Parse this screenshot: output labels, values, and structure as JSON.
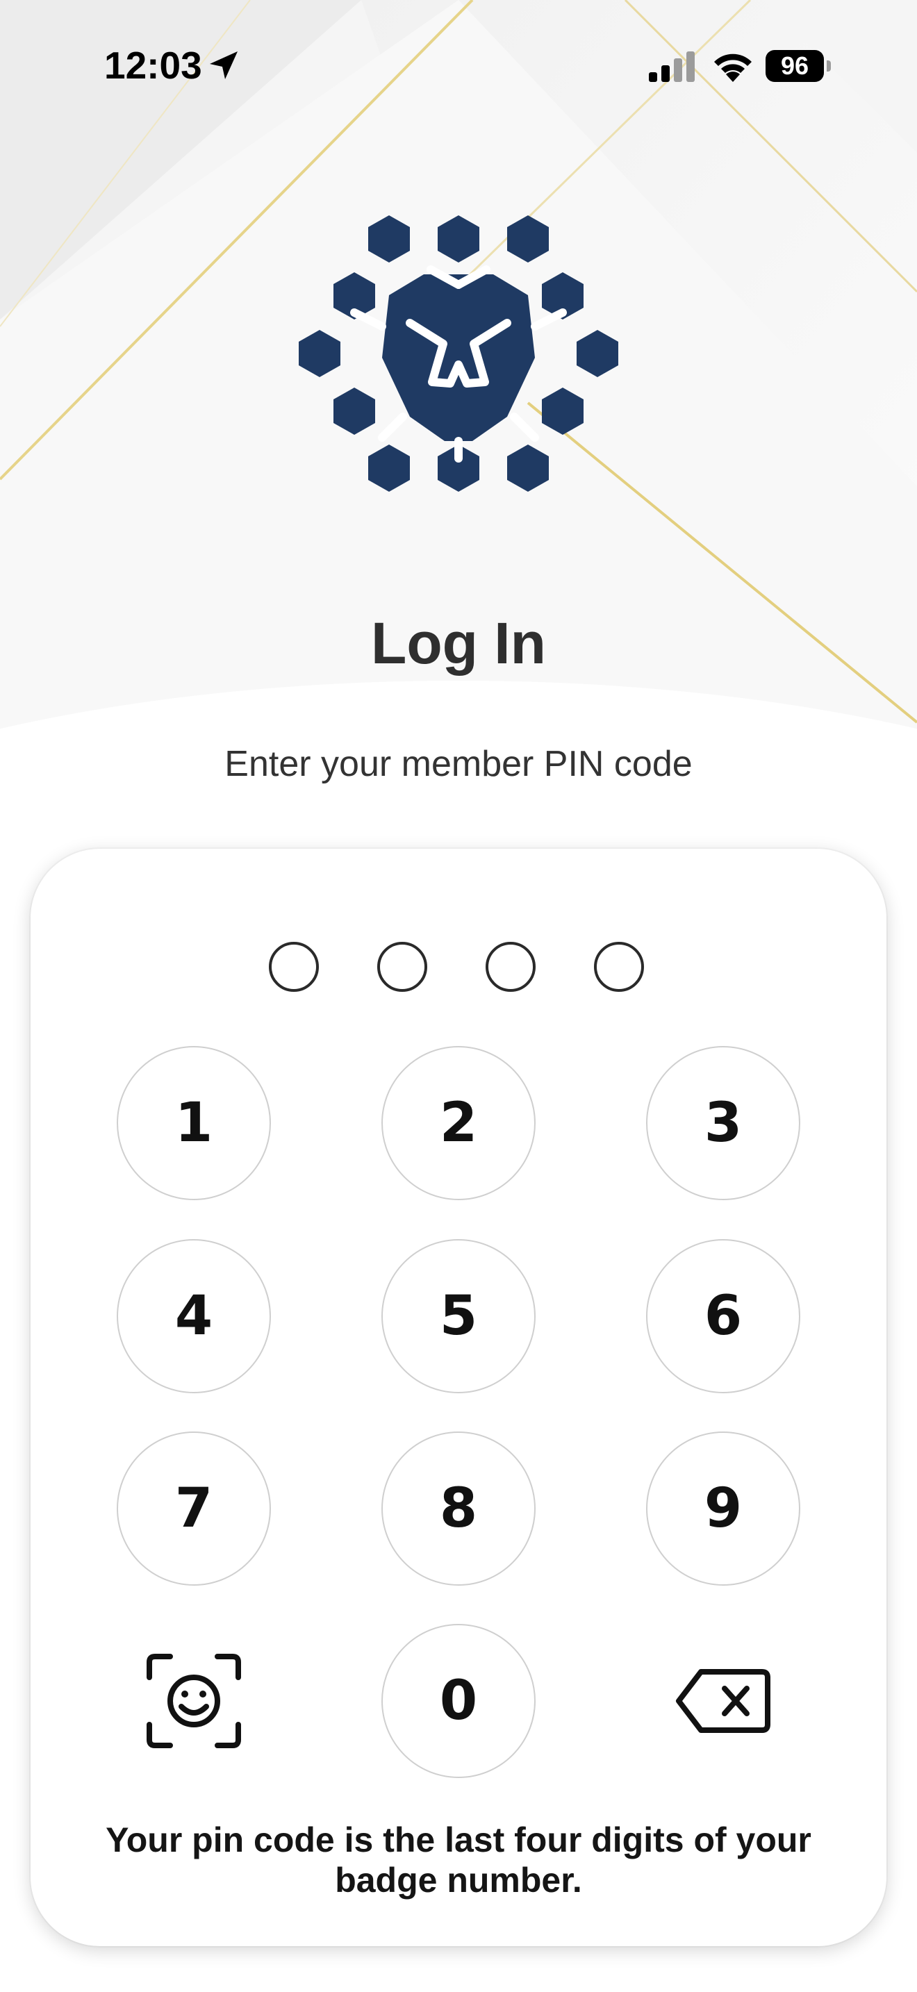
{
  "status_bar": {
    "time": "12:03",
    "battery": "96",
    "icons": [
      "location-arrow-icon",
      "cellular-signal-icon",
      "wifi-icon",
      "battery-icon"
    ]
  },
  "brand": {
    "logo": "lion-hexagon-logo",
    "logo_color": "#1f3a63",
    "accent_gold": "#d9c26b"
  },
  "login": {
    "title": "Log In",
    "subtitle": "Enter your member PIN code",
    "pin_length": 4,
    "pin_entered": 0,
    "keys": [
      "1",
      "2",
      "3",
      "4",
      "5",
      "6",
      "7",
      "8",
      "9",
      "0"
    ],
    "face_id_icon": "face-id-icon",
    "delete_icon": "backspace-icon",
    "hint": "Your pin code is the last four digits of your badge number."
  }
}
